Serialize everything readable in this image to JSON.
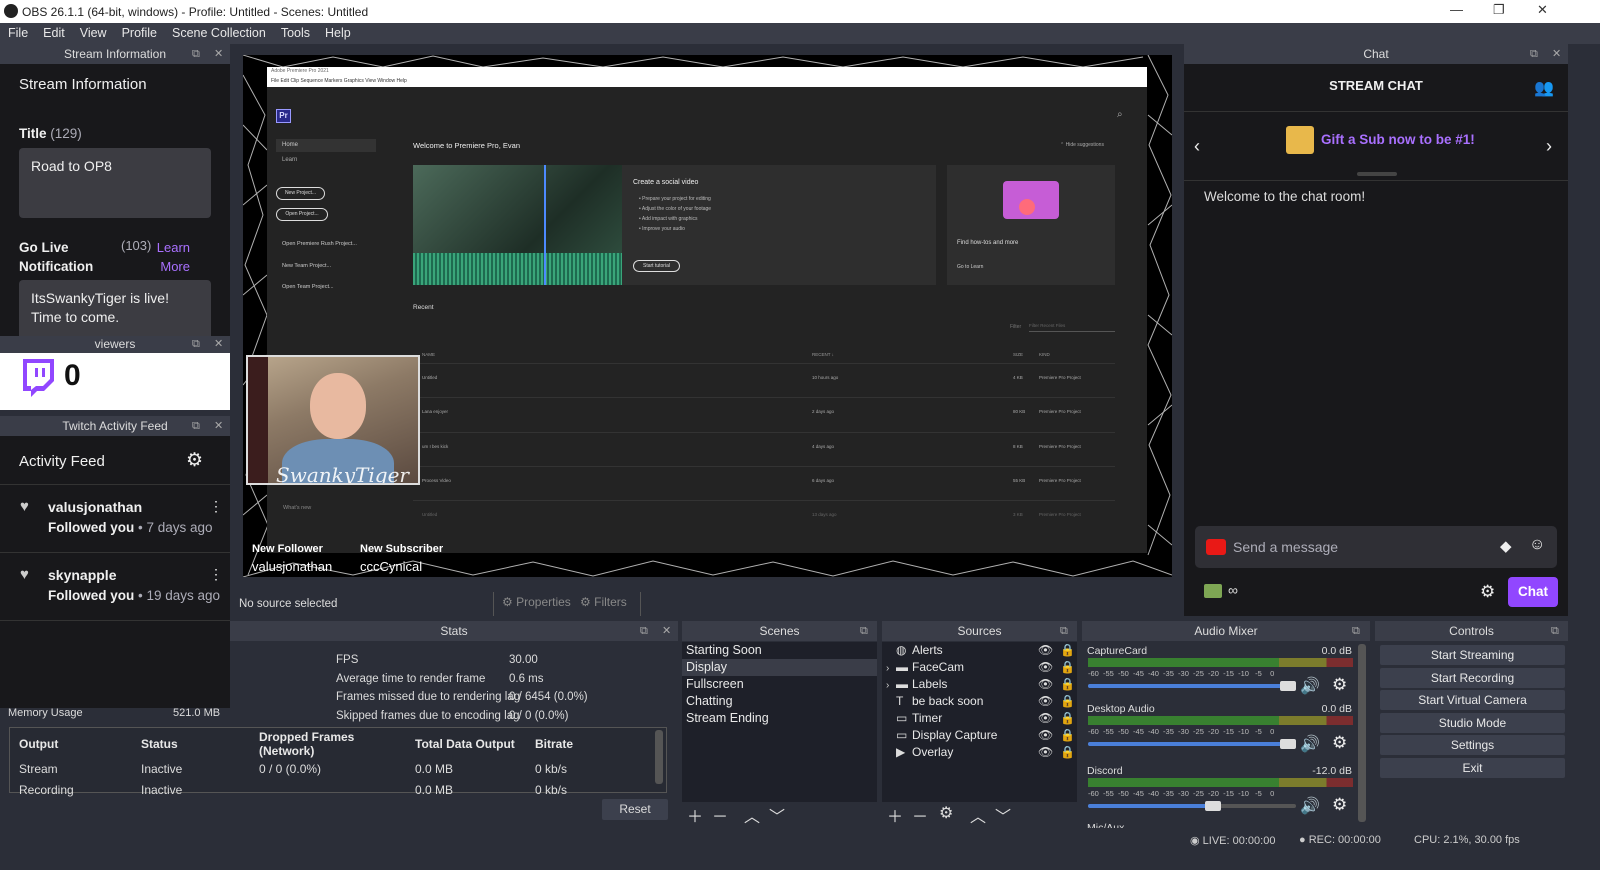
{
  "window": {
    "title": "OBS 26.1.1 (64-bit, windows) - Profile: Untitled - Scenes: Untitled"
  },
  "menu": [
    "File",
    "Edit",
    "View",
    "Profile",
    "Scene Collection",
    "Tools",
    "Help"
  ],
  "stream_info": {
    "dock_title": "Stream Information",
    "heading": "Stream Information",
    "title_label": "Title",
    "title_count": "(129)",
    "title_value": "Road to OP8",
    "golive_label": "Go Live Notification",
    "golive_count": "(103)",
    "learn_more": "Learn More",
    "golive_value": "ItsSwankyTiger is live! Time to come."
  },
  "viewers": {
    "dock_title": "viewers",
    "count": "0"
  },
  "activity": {
    "dock_title": "Twitch Activity Feed",
    "heading": "Activity Feed",
    "items": [
      {
        "user": "valusjonathan",
        "action": "Followed you",
        "time": " • 7 days ago"
      },
      {
        "user": "skynapple",
        "action": "Followed you",
        "time": " • 19 days ago"
      }
    ]
  },
  "preview": {
    "premiere_title": "Adobe Premiere Pro 2021",
    "premiere_menu": "File  Edit  Clip  Sequence  Markers  Graphics  View  Window  Help",
    "welcome": "Welcome to Premiere Pro, Evan",
    "hide": "Hide suggestions",
    "nav": [
      "Home",
      "Learn"
    ],
    "buttons": [
      "New Project...",
      "Open Project..."
    ],
    "links": [
      "Open Premiere Rush Project...",
      "New Team Project...",
      "Open Team Project..."
    ],
    "social_title": "Create a social video",
    "social_items": [
      "Prepare your project for editing",
      "Adjust the color of your footage",
      "Add impact with graphics",
      "Improve your audio"
    ],
    "start_tutorial": "Start tutorial",
    "howtos": "Find how-tos and more",
    "go_learn": "Go to Learn",
    "recent": "Recent",
    "filter": "Filter",
    "filter_placeholder": "Filter Recent Files",
    "cols": [
      "NAME",
      "RECENT ↓",
      "SIZE",
      "KIND"
    ],
    "rows": [
      [
        "Untitled",
        "10 hours ago",
        "4 KB",
        "Premiere Pro Project"
      ],
      [
        "Lana enjoyer",
        "2 days ago",
        "80 KB",
        "Premiere Pro Project"
      ],
      [
        "um I bes kick",
        "4 days ago",
        "8 KB",
        "Premiere Pro Project"
      ],
      [
        "Process Video",
        "6 days ago",
        "55 KB",
        "Premiere Pro Project"
      ],
      [
        "Untitled",
        "13 days ago",
        "3 KB",
        "Premiere Pro Project"
      ]
    ],
    "whats_new": "What's new",
    "webcam_text": "SwankyTiger",
    "new_follower_label": "New Follower",
    "new_follower": "valusjonathan",
    "new_sub_label": "New Subscriber",
    "new_sub": "cccCynical"
  },
  "source_bar": {
    "none": "No source selected",
    "properties": "Properties",
    "filters": "Filters"
  },
  "chat": {
    "dock_title": "Chat",
    "heading": "STREAM CHAT",
    "gift": "Gift a Sub now to be #1!",
    "welcome": "Welcome to the chat room!",
    "placeholder": "Send a message",
    "points": "∞",
    "send": "Chat"
  },
  "stats": {
    "dock_title": "Stats",
    "rows": [
      [
        "FPS",
        "30.00"
      ],
      [
        "Average time to render frame",
        "0.6 ms"
      ],
      [
        "Frames missed due to rendering lag",
        "0 / 6454 (0.0%)"
      ],
      [
        "Skipped frames due to encoding lag",
        "0 / 0 (0.0%)"
      ]
    ],
    "memory_label": "Memory Usage",
    "memory_value": "521.0 MB",
    "table_head": [
      "Output",
      "Status",
      "Dropped Frames (Network)",
      "Total Data Output",
      "Bitrate"
    ],
    "table_rows": [
      [
        "Stream",
        "Inactive",
        "0 / 0 (0.0%)",
        "0.0 MB",
        "0 kb/s"
      ],
      [
        "Recording",
        "Inactive",
        "",
        "0.0 MB",
        "0 kb/s"
      ]
    ],
    "reset": "Reset"
  },
  "scenes": {
    "dock_title": "Scenes",
    "items": [
      "Starting Soon",
      "Display",
      "Fullscreen",
      "Chatting",
      "Stream Ending"
    ],
    "selected": 1
  },
  "sources": {
    "dock_title": "Sources",
    "items": [
      {
        "name": "Alerts",
        "icon": "globe-icon",
        "expand": false
      },
      {
        "name": "FaceCam",
        "icon": "folder-icon",
        "expand": true
      },
      {
        "name": "Labels",
        "icon": "folder-icon",
        "expand": true
      },
      {
        "name": "be back soon",
        "icon": "text-icon",
        "expand": false
      },
      {
        "name": "Timer",
        "icon": "window-icon",
        "expand": false
      },
      {
        "name": "Display Capture",
        "icon": "monitor-icon",
        "expand": false
      },
      {
        "name": "Overlay",
        "icon": "play-icon",
        "expand": false
      }
    ]
  },
  "mixer": {
    "dock_title": "Audio Mixer",
    "channels": [
      {
        "name": "CaptureCard",
        "db": "0.0 dB",
        "level": 0.96
      },
      {
        "name": "Desktop Audio",
        "db": "0.0 dB",
        "level": 0.96
      },
      {
        "name": "Discord",
        "db": "-12.0 dB",
        "level": 0.6
      }
    ],
    "scale": "-60  -55  -50  -45  -40  -35  -30  -25  -20  -15  -10   -5    0",
    "next": "Mic/Aux"
  },
  "controls": {
    "dock_title": "Controls",
    "buttons": [
      "Start Streaming",
      "Start Recording",
      "Start Virtual Camera",
      "Studio Mode",
      "Settings",
      "Exit"
    ]
  },
  "status": {
    "live": "LIVE: 00:00:00",
    "rec": "REC: 00:00:00",
    "cpu": "CPU: 2.1%, 30.00 fps"
  }
}
